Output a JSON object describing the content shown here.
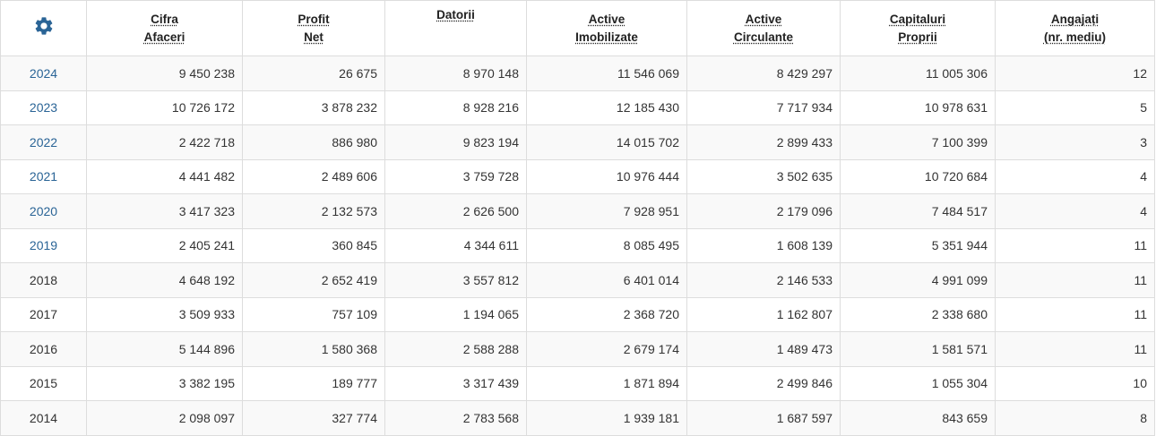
{
  "colors": {
    "link": "#2a6496",
    "gear": "#2a6496"
  },
  "header": {
    "settings_icon": "gear-icon",
    "columns": [
      {
        "line1": "Cifra",
        "line2": "Afaceri"
      },
      {
        "line1": "Profit",
        "line2": "Net"
      },
      {
        "line1": "Datorii",
        "line2": ""
      },
      {
        "line1": "Active",
        "line2": "Imobilizate"
      },
      {
        "line1": "Active",
        "line2": "Circulante"
      },
      {
        "line1": "Capitaluri",
        "line2": "Proprii"
      },
      {
        "line1": "Angajați",
        "line2": "(nr. mediu)"
      }
    ]
  },
  "rows": [
    {
      "year": "2024",
      "link": true,
      "values": [
        "9 450 238",
        "26 675",
        "8 970 148",
        "11 546 069",
        "8 429 297",
        "11 005 306",
        "12"
      ]
    },
    {
      "year": "2023",
      "link": true,
      "values": [
        "10 726 172",
        "3 878 232",
        "8 928 216",
        "12 185 430",
        "7 717 934",
        "10 978 631",
        "5"
      ]
    },
    {
      "year": "2022",
      "link": true,
      "values": [
        "2 422 718",
        "886 980",
        "9 823 194",
        "14 015 702",
        "2 899 433",
        "7 100 399",
        "3"
      ]
    },
    {
      "year": "2021",
      "link": true,
      "values": [
        "4 441 482",
        "2 489 606",
        "3 759 728",
        "10 976 444",
        "3 502 635",
        "10 720 684",
        "4"
      ]
    },
    {
      "year": "2020",
      "link": true,
      "values": [
        "3 417 323",
        "2 132 573",
        "2 626 500",
        "7 928 951",
        "2 179 096",
        "7 484 517",
        "4"
      ]
    },
    {
      "year": "2019",
      "link": true,
      "values": [
        "2 405 241",
        "360 845",
        "4 344 611",
        "8 085 495",
        "1 608 139",
        "5 351 944",
        "11"
      ]
    },
    {
      "year": "2018",
      "link": false,
      "values": [
        "4 648 192",
        "2 652 419",
        "3 557 812",
        "6 401 014",
        "2 146 533",
        "4 991 099",
        "11"
      ]
    },
    {
      "year": "2017",
      "link": false,
      "values": [
        "3 509 933",
        "757 109",
        "1 194 065",
        "2 368 720",
        "1 162 807",
        "2 338 680",
        "11"
      ]
    },
    {
      "year": "2016",
      "link": false,
      "values": [
        "5 144 896",
        "1 580 368",
        "2 588 288",
        "2 679 174",
        "1 489 473",
        "1 581 571",
        "11"
      ]
    },
    {
      "year": "2015",
      "link": false,
      "values": [
        "3 382 195",
        "189 777",
        "3 317 439",
        "1 871 894",
        "2 499 846",
        "1 055 304",
        "10"
      ]
    },
    {
      "year": "2014",
      "link": false,
      "values": [
        "2 098 097",
        "327 774",
        "2 783 568",
        "1 939 181",
        "1 687 597",
        "843 659",
        "8"
      ]
    }
  ]
}
